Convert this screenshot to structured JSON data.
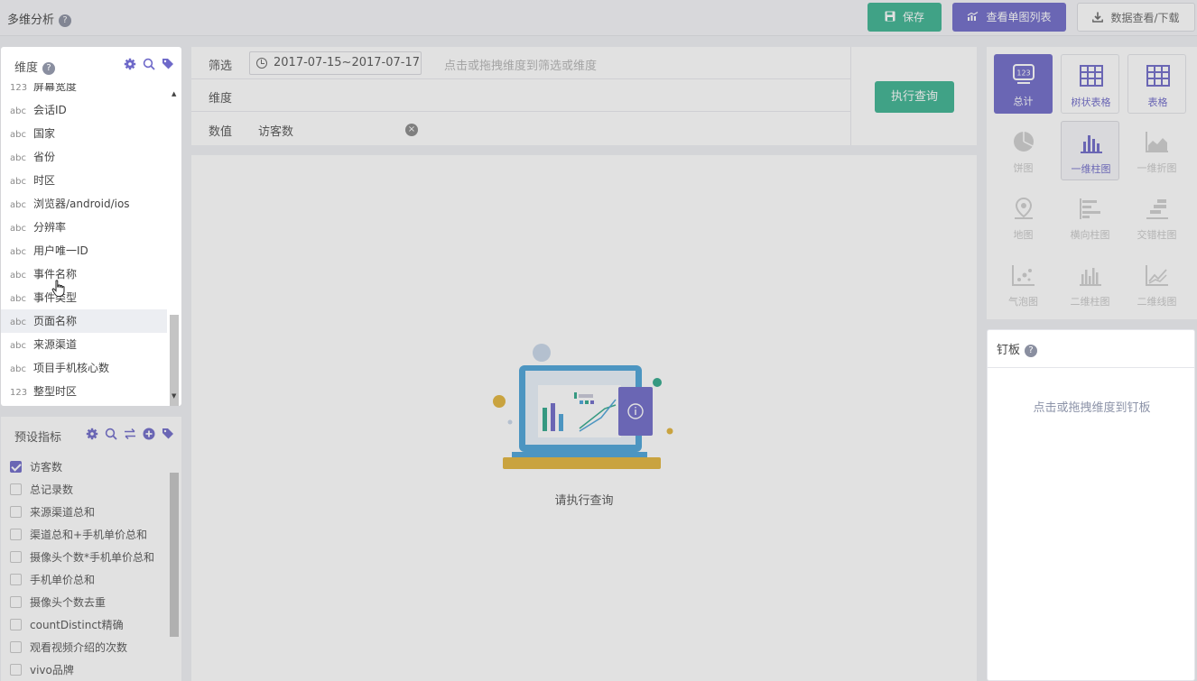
{
  "app": {
    "title": "多维分析",
    "help": "?"
  },
  "toolbar": {
    "save_label": "保存",
    "list_label": "查看单图列表",
    "data_label": "数据查看/下载"
  },
  "dimensions": {
    "title": "维度",
    "items": [
      {
        "type": "123",
        "label": "屏幕宽度"
      },
      {
        "type": "abc",
        "label": "会话ID"
      },
      {
        "type": "abc",
        "label": "国家"
      },
      {
        "type": "abc",
        "label": "省份"
      },
      {
        "type": "abc",
        "label": "时区"
      },
      {
        "type": "abc",
        "label": "浏览器/android/ios"
      },
      {
        "type": "abc",
        "label": "分辨率"
      },
      {
        "type": "abc",
        "label": "用户唯一ID"
      },
      {
        "type": "abc",
        "label": "事件名称"
      },
      {
        "type": "abc",
        "label": "事件类型"
      },
      {
        "type": "abc",
        "label": "页面名称"
      },
      {
        "type": "abc",
        "label": "来源渠道"
      },
      {
        "type": "abc",
        "label": "项目手机核心数"
      },
      {
        "type": "123",
        "label": "整型时区"
      }
    ]
  },
  "metrics": {
    "title": "预设指标",
    "items": [
      {
        "label": "访客数",
        "checked": true
      },
      {
        "label": "总记录数",
        "checked": false
      },
      {
        "label": "来源渠道总和",
        "checked": false
      },
      {
        "label": "渠道总和+手机单价总和",
        "checked": false
      },
      {
        "label": "摄像头个数*手机单价总和",
        "checked": false
      },
      {
        "label": "手机单价总和",
        "checked": false
      },
      {
        "label": "摄像头个数去重",
        "checked": false
      },
      {
        "label": "countDistinct精确",
        "checked": false
      },
      {
        "label": "观看视频介绍的次数",
        "checked": false
      },
      {
        "label": "vivo品牌",
        "checked": false
      }
    ]
  },
  "query": {
    "filter_label": "筛选",
    "date_range": "2017-07-15~2017-07-17",
    "filter_hint": "点击或拖拽维度到筛选或维度",
    "dimension_label": "维度",
    "value_label": "数值",
    "value_chip": "访客数",
    "run_label": "执行查询"
  },
  "result": {
    "empty_text": "请执行查询"
  },
  "chart_types": [
    {
      "label": "总计",
      "icon": "total-icon",
      "state": "active"
    },
    {
      "label": "树状表格",
      "icon": "tree-table-icon",
      "state": "normal"
    },
    {
      "label": "表格",
      "icon": "table-icon",
      "state": "normal"
    },
    {
      "label": "饼图",
      "icon": "pie-chart-icon",
      "state": "disabled"
    },
    {
      "label": "一维柱图",
      "icon": "bar-chart-icon",
      "state": "hover"
    },
    {
      "label": "一维折图",
      "icon": "area-chart-icon",
      "state": "disabled"
    },
    {
      "label": "地图",
      "icon": "map-pin-icon",
      "state": "disabled"
    },
    {
      "label": "横向柱图",
      "icon": "horizontal-bar-icon",
      "state": "disabled"
    },
    {
      "label": "交错柱图",
      "icon": "staggered-bar-icon",
      "state": "disabled"
    },
    {
      "label": "气泡图",
      "icon": "bubble-chart-icon",
      "state": "disabled"
    },
    {
      "label": "二维柱图",
      "icon": "grouped-bar-icon",
      "state": "disabled"
    },
    {
      "label": "二维线图",
      "icon": "line-chart-icon",
      "state": "disabled"
    }
  ],
  "pinboard": {
    "title": "钉板",
    "hint": "点击或拖拽维度到钉板"
  },
  "colors": {
    "green": "#3bb390",
    "purple": "#6e69c9"
  }
}
